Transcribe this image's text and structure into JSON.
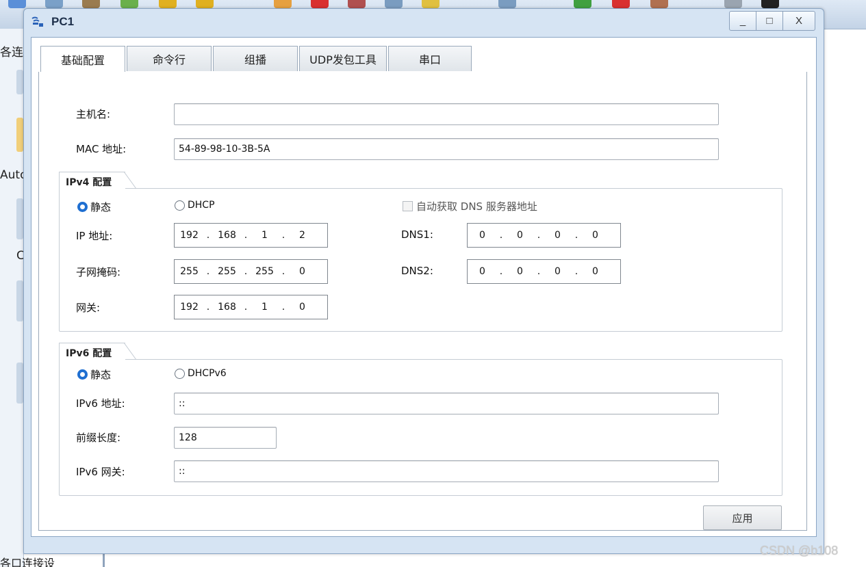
{
  "background": {
    "left_labels": [
      "各连",
      "Auto",
      "C"
    ],
    "bottom_text": "各口连接设"
  },
  "watermark": "CSDN @b108",
  "window": {
    "title": "PC1",
    "buttons": {
      "minimize": "_",
      "maximize": "□",
      "close": "X"
    }
  },
  "tabs": [
    {
      "label": "基础配置",
      "active": true
    },
    {
      "label": "命令行",
      "active": false
    },
    {
      "label": "组播",
      "active": false
    },
    {
      "label": "UDP发包工具",
      "active": false
    },
    {
      "label": "串口",
      "active": false
    }
  ],
  "basic": {
    "hostname_label": "主机名:",
    "hostname_value": "",
    "mac_label": "MAC 地址:",
    "mac_value": "54-89-98-10-3B-5A"
  },
  "ipv4": {
    "group_title": "IPv4 配置",
    "static_label": "静态",
    "dhcp_label": "DHCP",
    "mode": "static",
    "auto_dns_label": "自动获取 DNS 服务器地址",
    "auto_dns_checked": false,
    "ip_label": "IP 地址:",
    "ip_value": [
      "192",
      "168",
      "1",
      "2"
    ],
    "mask_label": "子网掩码:",
    "mask_value": [
      "255",
      "255",
      "255",
      "0"
    ],
    "gateway_label": "网关:",
    "gateway_value": [
      "192",
      "168",
      "1",
      "0"
    ],
    "dns1_label": "DNS1:",
    "dns1_value": [
      "0",
      "0",
      "0",
      "0"
    ],
    "dns2_label": "DNS2:",
    "dns2_value": [
      "0",
      "0",
      "0",
      "0"
    ]
  },
  "ipv6": {
    "group_title": "IPv6 配置",
    "static_label": "静态",
    "dhcp_label": "DHCPv6",
    "mode": "static",
    "address_label": "IPv6 地址:",
    "address_value": "::",
    "prefix_label": "前缀长度:",
    "prefix_value": "128",
    "gateway_label": "IPv6 网关:",
    "gateway_value": "::"
  },
  "apply_label": "应用",
  "colors": {
    "accent": "#1f6fd1",
    "window_frame": "#d6e4f3"
  }
}
